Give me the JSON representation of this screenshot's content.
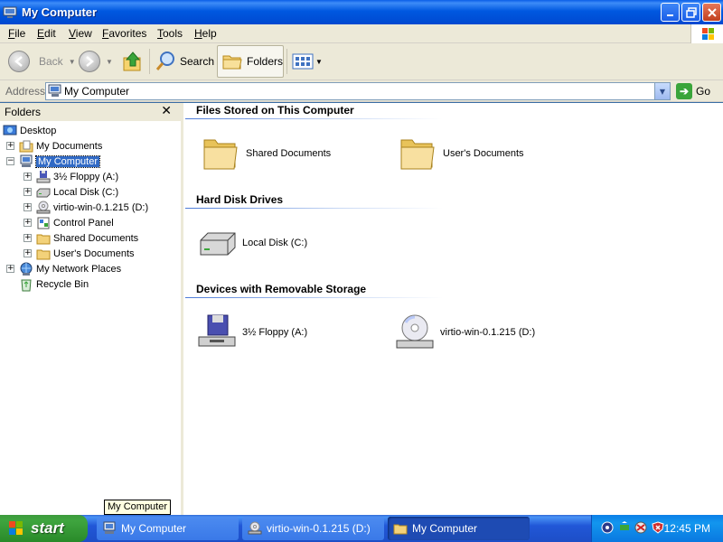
{
  "window": {
    "title": "My Computer"
  },
  "menu": [
    "File",
    "Edit",
    "View",
    "Favorites",
    "Tools",
    "Help"
  ],
  "toolbar": {
    "back": "Back",
    "search": "Search",
    "folders": "Folders"
  },
  "address": {
    "label": "Address",
    "value": "My Computer",
    "go": "Go"
  },
  "folders_pane": {
    "title": "Folders",
    "tree": [
      {
        "label": "Desktop",
        "icon": "desktop-icon"
      },
      {
        "label": "My Documents",
        "icon": "my-documents-icon"
      },
      {
        "label": "My Computer",
        "icon": "my-computer-icon",
        "selected": true
      },
      {
        "label": "3½ Floppy (A:)",
        "icon": "floppy-drive-icon"
      },
      {
        "label": "Local Disk (C:)",
        "icon": "hard-disk-icon"
      },
      {
        "label": "virtio-win-0.1.215 (D:)",
        "icon": "cd-drive-icon"
      },
      {
        "label": "Control Panel",
        "icon": "control-panel-icon"
      },
      {
        "label": "Shared Documents",
        "icon": "folder-icon"
      },
      {
        "label": "User's Documents",
        "icon": "folder-icon"
      },
      {
        "label": "My Network Places",
        "icon": "network-places-icon"
      },
      {
        "label": "Recycle Bin",
        "icon": "recycle-bin-icon"
      }
    ]
  },
  "main": {
    "groups": [
      {
        "title": "Files Stored on This Computer",
        "items": [
          "Shared Documents",
          "User's Documents"
        ]
      },
      {
        "title": "Hard Disk Drives",
        "items": [
          "Local Disk (C:)"
        ]
      },
      {
        "title": "Devices with Removable Storage",
        "items": [
          "3½ Floppy (A:)",
          "virtio-win-0.1.215 (D:)"
        ]
      }
    ]
  },
  "tooltip": "My Computer",
  "taskbar": {
    "start": "start",
    "tasks": [
      "My Computer",
      "virtio-win-0.1.215 (D:)",
      "My Computer"
    ],
    "clock": "12:45 PM"
  }
}
